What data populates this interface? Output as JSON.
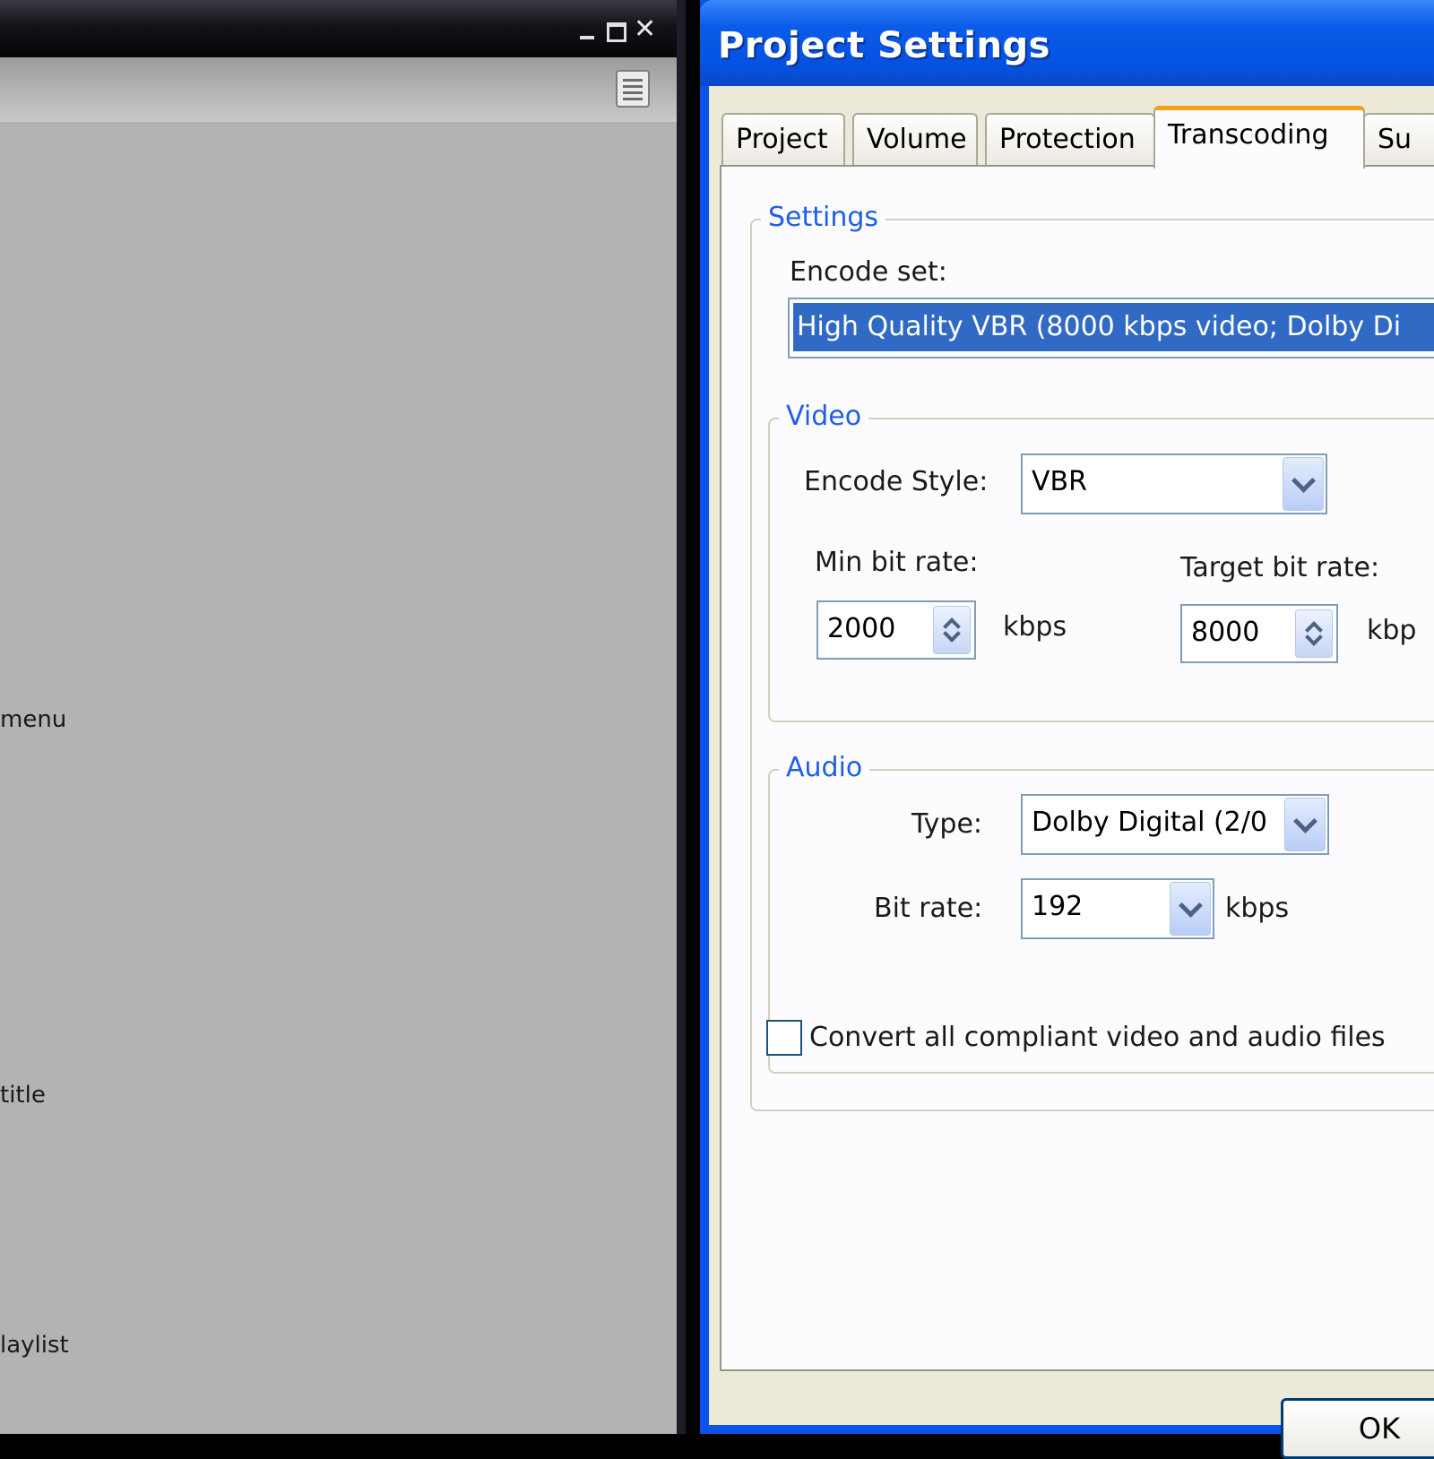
{
  "background_window": {
    "items": [
      "menu",
      "title",
      "laylist"
    ]
  },
  "dialog": {
    "title": "Project Settings",
    "tabs": [
      "Project",
      "Volume",
      "Protection",
      "Transcoding",
      "Su"
    ],
    "active_tab": "Transcoding",
    "settings": {
      "legend": "Settings",
      "encode_set_label": "Encode set:",
      "encode_set_value": "High Quality VBR (8000 kbps video; Dolby Di"
    },
    "video": {
      "legend": "Video",
      "encode_style_label": "Encode Style:",
      "encode_style_value": "VBR",
      "min_bit_rate_label": "Min bit rate:",
      "min_bit_rate_value": "2000",
      "min_unit": "kbps",
      "target_bit_rate_label": "Target bit rate:",
      "target_bit_rate_value": "8000",
      "target_unit": "kbp"
    },
    "audio": {
      "legend": "Audio",
      "type_label": "Type:",
      "type_value": "Dolby Digital (2/0",
      "bit_rate_label": "Bit rate:",
      "bit_rate_value": "192",
      "bit_rate_unit": "kbps"
    },
    "convert_checkbox_label": "Convert all compliant video and audio files",
    "convert_checked": false,
    "ok_label": "OK"
  }
}
